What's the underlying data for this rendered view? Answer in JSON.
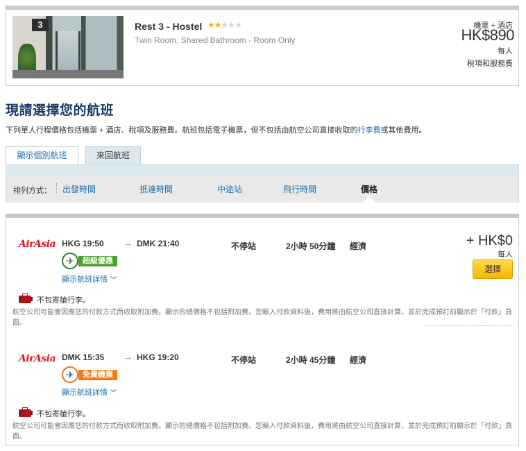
{
  "hotel": {
    "name": "Rest 3 - Hostel",
    "star_rating": 2,
    "star_max": 5,
    "room_type": "Twin Room, Shared Bathroom - Room Only",
    "package_label": "機票 + 酒店",
    "package_price": "HK$890",
    "per_person": "每人",
    "tax_note": "稅項和服務費",
    "photo_sign": "3"
  },
  "heading": {
    "title": "現請選擇您的航班",
    "desc_prefix": "下列單人行程價格包括機票 + 酒店、稅項及服務費。航班包括電子機票，但不包括由航空公司直接收取的",
    "desc_link": "行李費",
    "desc_suffix": "或其他費用。"
  },
  "tabs": [
    {
      "label": "顯示個別航班"
    },
    {
      "label": "來回航班"
    }
  ],
  "sort": {
    "label": "排列方式：",
    "options": [
      "出發時間",
      "抵達時間",
      "中途站",
      "飛行時間",
      "價格"
    ],
    "active": "價格"
  },
  "flights": [
    {
      "airline": "AirAsia",
      "dep": "HKG 19:50",
      "arrow": "→",
      "arr": "DMK 21:40",
      "stops": "不停站",
      "duration": "2小時 50分鐘",
      "cabin": "經濟",
      "badge": "超級優惠",
      "details": "顯示航班詳情",
      "price": "+ HK$0",
      "per": "每人",
      "select": "選擇",
      "baggage": "不包寄艙行李。",
      "fee_note": "航空公司可能會因應您的付款方式而收取附加費。顯示的總價格不包括附加費。您輸入付款資料後，費用將由航空公司直接計算，並於完成預訂前顯示於「付款」頁面。"
    },
    {
      "airline": "AirAsia",
      "dep": "DMK 15:35",
      "arrow": "→",
      "arr": "HKG 19:20",
      "stops": "不停站",
      "duration": "2小時 45分鐘",
      "cabin": "經濟",
      "badge": "免費機票",
      "details": "顯示航班詳情",
      "baggage": "不包寄艙行李。",
      "fee_note": "航空公司可能會因應您的付款方式而收取附加費。顯示的總價格不包括附加費。您輸入付款資料後，費用將由航空公司直接計算，並於完成預訂前顯示於「付款」頁面。"
    }
  ],
  "colors": {
    "title_blue": "#1a3a66",
    "link_blue": "#1a6fb0",
    "airasia_red": "#d71920",
    "badge_green": "#4aa329",
    "badge_orange": "#ef7d1e",
    "button_yellow": "#f3b800",
    "star_gold": "#f2b21b"
  }
}
